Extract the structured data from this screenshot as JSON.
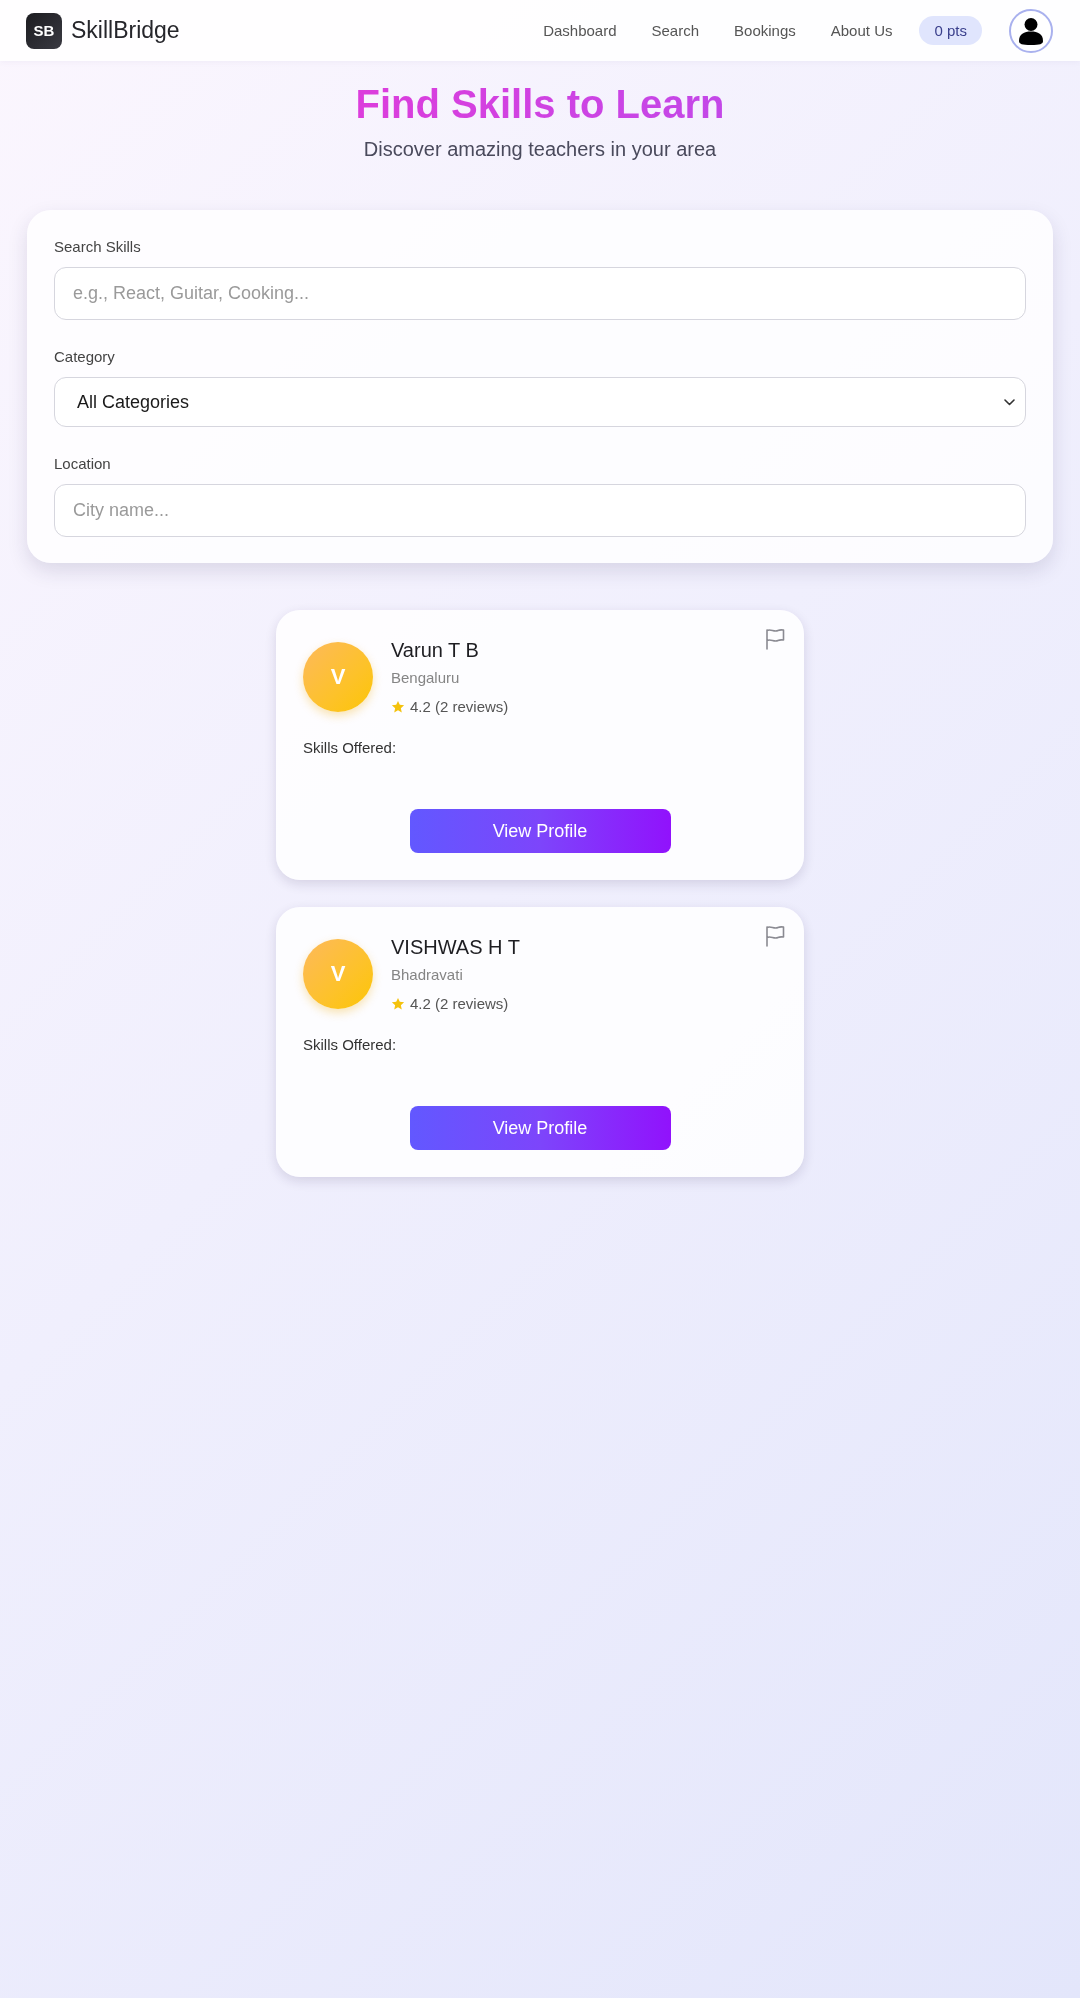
{
  "header": {
    "logo_mark": "SB",
    "brand": "SkillBridge",
    "nav": [
      "Dashboard",
      "Search",
      "Bookings",
      "About Us"
    ],
    "points": "0 pts"
  },
  "hero": {
    "title": "Find Skills to Learn",
    "subtitle": "Discover amazing teachers in your area"
  },
  "filters": [
    {
      "kind": "text",
      "label": "Search Skills",
      "placeholder": "e.g., React, Guitar, Cooking..."
    },
    {
      "kind": "select",
      "label": "Category",
      "value": "All Categories"
    },
    {
      "kind": "text",
      "label": "Location",
      "placeholder": "City name..."
    }
  ],
  "teachers": [
    {
      "initial": "V",
      "name": "Varun T B",
      "location": "Bengaluru",
      "rating": "4.2 (2 reviews)",
      "skills_label": "Skills Offered:",
      "button": "View Profile"
    },
    {
      "initial": "V",
      "name": "VISHWAS H T",
      "location": "Bhadravati",
      "rating": "4.2 (2 reviews)",
      "skills_label": "Skills Offered:",
      "button": "View Profile"
    }
  ]
}
